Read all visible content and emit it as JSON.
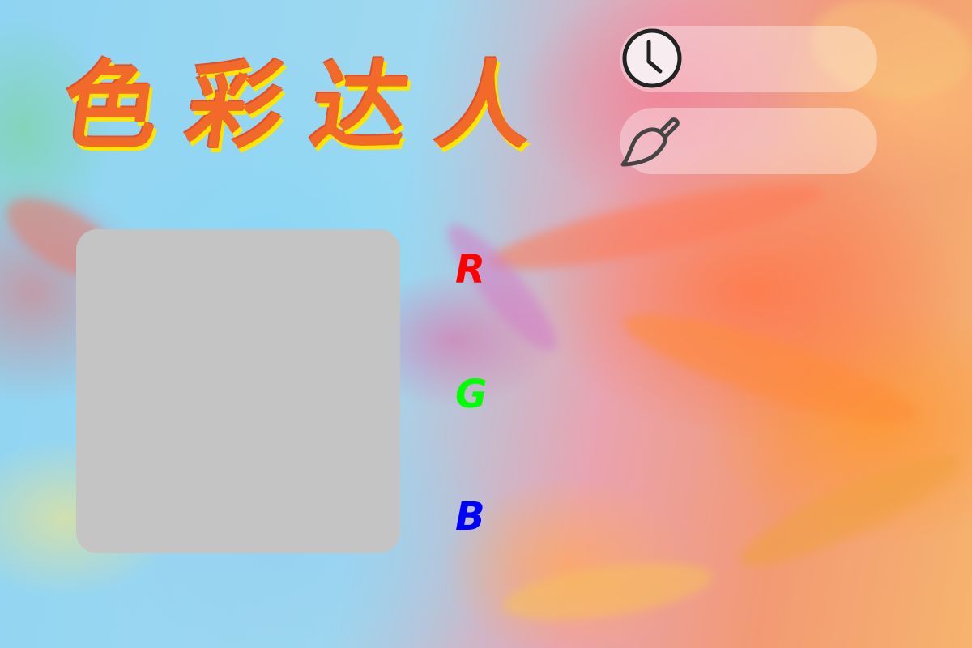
{
  "app": {
    "title": "色彩达人"
  },
  "hud": {
    "timer_icon": "clock-icon",
    "timer_value": "",
    "brush_icon": "paintbrush-icon",
    "brush_value": ""
  },
  "swatch": {
    "color": "#c4c4c4"
  },
  "channels": [
    {
      "label": "R",
      "color": "#ff0000"
    },
    {
      "label": "G",
      "color": "#00ff00"
    },
    {
      "label": "B",
      "color": "#0000ff"
    }
  ],
  "colors": {
    "title_fill": "#f26a2a",
    "title_shadow": "#ffe600",
    "icon_stroke": "#333333"
  }
}
